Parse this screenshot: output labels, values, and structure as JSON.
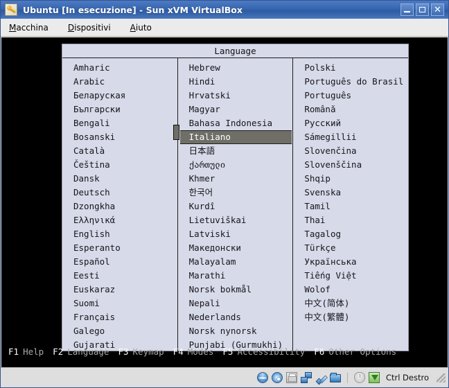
{
  "window": {
    "title": "Ubuntu [In esecuzione] - Sun xVM VirtualBox",
    "icon": "virtualbox-icon",
    "buttons": {
      "minimize": "minimize-button",
      "maximize": "maximize-button",
      "close": "close-button"
    }
  },
  "menubar": {
    "items": [
      {
        "accelerator": "M",
        "rest": "acchina"
      },
      {
        "accelerator": "D",
        "rest": "ispositivi"
      },
      {
        "accelerator": "A",
        "rest": "iuto"
      }
    ]
  },
  "dialog": {
    "title": "Language",
    "selected_language": "Italiano",
    "columns": [
      {
        "items": [
          "Amharic",
          "Arabic",
          "Беларуская",
          "Български",
          "Bengali",
          "Bosanski",
          "Català",
          "Čeština",
          "Dansk",
          "Deutsch",
          "Dzongkha",
          "Ελληνικά",
          "English",
          "Esperanto",
          "Español",
          "Eesti",
          "Euskaraz",
          "Suomi",
          "Français",
          "Galego",
          "Gujarati"
        ]
      },
      {
        "items": [
          "Hebrew",
          "Hindi",
          "Hrvatski",
          "Magyar",
          "Bahasa Indonesia",
          "Italiano",
          "日本語",
          "ქართული",
          "Khmer",
          "한국어",
          "Kurdî",
          "Lietuviškai",
          "Latviski",
          "Македонски",
          "Malayalam",
          "Marathi",
          "Norsk bokmål",
          "Nepali",
          "Nederlands",
          "Norsk nynorsk",
          "Punjabi (Gurmukhi)"
        ]
      },
      {
        "items": [
          "Polski",
          "Português do Brasil",
          "Português",
          "Română",
          "Русский",
          "Sámegillii",
          "Slovenčina",
          "Slovenščina",
          "Shqip",
          "Svenska",
          "Tamil",
          "Thai",
          "Tagalog",
          "Türkçe",
          "Українська",
          "Tiếng Việt",
          "Wolof",
          "中文(简体)",
          "中文(繁體)"
        ]
      }
    ]
  },
  "function_keys": [
    {
      "key": "F1",
      "label": "Help"
    },
    {
      "key": "F2",
      "label": "Language"
    },
    {
      "key": "F3",
      "label": "Keymap"
    },
    {
      "key": "F4",
      "label": "Modes"
    },
    {
      "key": "F5",
      "label": "Accessibility"
    },
    {
      "key": "F6",
      "label": "Other Options"
    }
  ],
  "statusbar": {
    "icons": [
      "harddisk-icon",
      "cd-dvd-icon",
      "floppy-icon",
      "network-icon",
      "usb-icon",
      "shared-folder-icon",
      "mouse-integration-icon",
      "host-key-icon"
    ],
    "host_key": "Ctrl Destro"
  },
  "colors": {
    "titlebar_blue": "#3866ae",
    "dialog_bg": "#d7dae8",
    "selection_gray": "#6f6f67",
    "vm_black": "#000000",
    "fkey_white": "#ffffff",
    "fkey_gray": "#a8a8a8"
  }
}
